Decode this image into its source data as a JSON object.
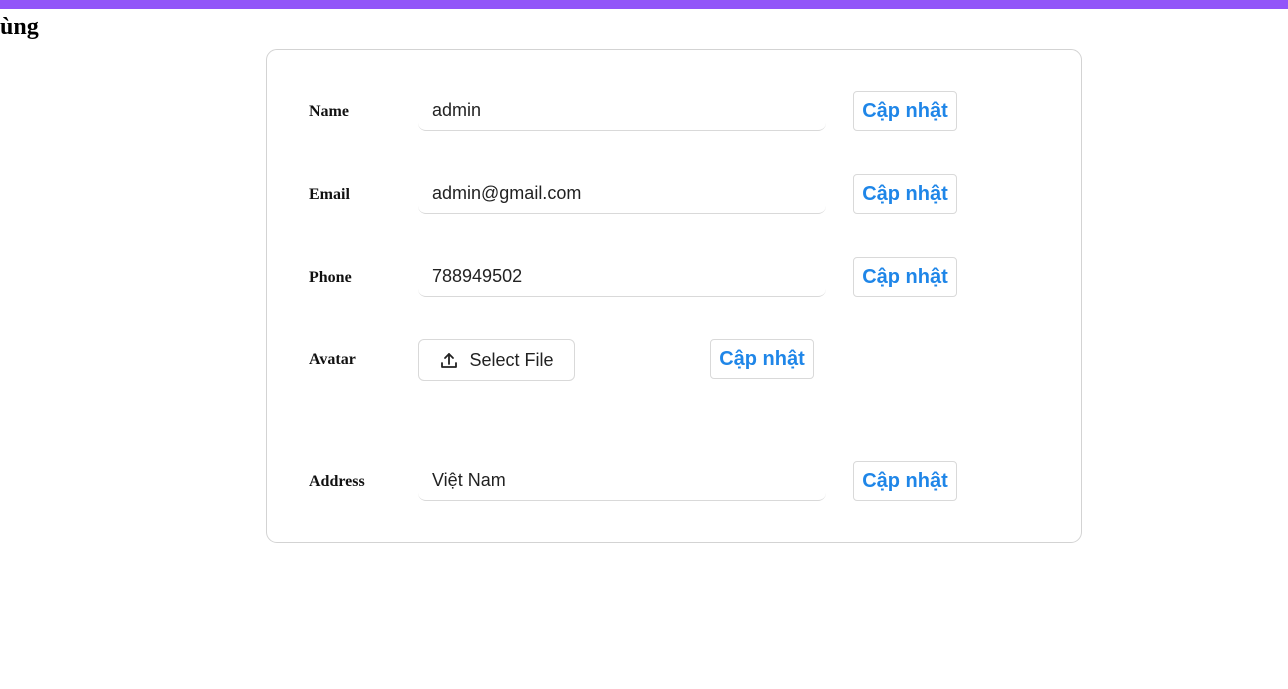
{
  "page": {
    "heading": "ùng"
  },
  "colors": {
    "top_bar": "#9254f9",
    "button_text": "#1f86e8"
  },
  "form": {
    "update_label": "Cập nhật",
    "fields": {
      "name": {
        "label": "Name",
        "value": "admin"
      },
      "email": {
        "label": "Email",
        "value": "admin@gmail.com"
      },
      "phone": {
        "label": "Phone",
        "value": "788949502"
      },
      "avatar": {
        "label": "Avatar",
        "select_file_label": "Select File",
        "icon": "upload-icon"
      },
      "address": {
        "label": "Address",
        "value": "Việt Nam"
      }
    }
  }
}
